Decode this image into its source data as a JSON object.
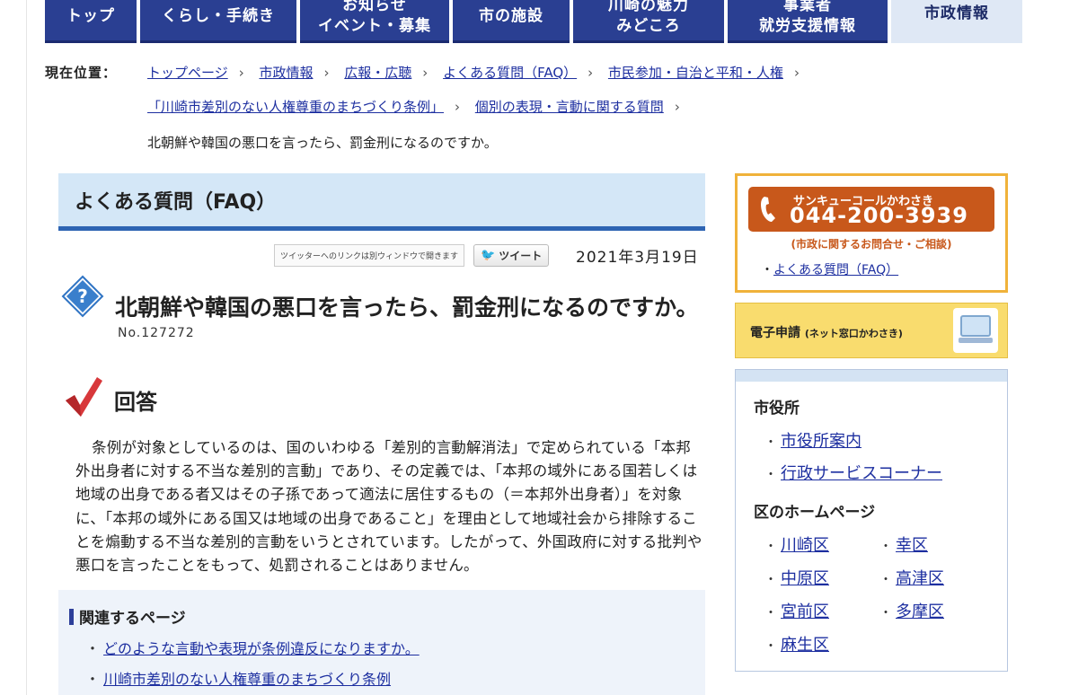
{
  "nav": {
    "items": [
      {
        "label": "トップ",
        "active": false
      },
      {
        "label": "くらし・手続き",
        "active": false
      },
      {
        "label": "お知らせ\nイベント・募集",
        "active": false
      },
      {
        "label": "市の施設",
        "active": false
      },
      {
        "label": "川崎の魅力\nみどころ",
        "active": false
      },
      {
        "label": "事業者\n就労支援情報",
        "active": false
      },
      {
        "label": "市政情報",
        "active": true
      }
    ]
  },
  "breadcrumb": {
    "label": "現在位置：",
    "links": [
      "トップページ",
      "市政情報",
      "広報・広聴",
      "よくある質問（FAQ）",
      "市民参加・自治と平和・人権",
      "「川崎市差別のない人権尊重のまちづくり条例」",
      "個別の表現・言動に関する質問"
    ],
    "separator": "›",
    "current": "北朝鮮や韓国の悪口を言ったら、罰金刑になるのですか。"
  },
  "faq": {
    "heading": "よくある質問（FAQ）",
    "twitter_note": "ツイッターへのリンクは別ウィンドウで開きます",
    "tweet_label": "ツイート",
    "date": "2021年3月19日",
    "question_title": "北朝鮮や韓国の悪口を言ったら、罰金刑になるのですか。",
    "question_no": "No.127272",
    "answer_heading": "回答",
    "answer_text": "条例が対象としているのは、国のいわゆる「差別的言動解消法」で定められている「本邦外出身者に対する不当な差別的言動」であり、その定義では、「本邦の域外にある国若しくは地域の出身である者又はその子孫であって適法に居住するもの（＝本邦外出身者）」を対象に、「本邦の域外にある国又は地域の出身であること」を理由として地域社会から排除することを煽動する不当な差別的言動をいうとされています。したがって、外国政府に対する批判や悪口を言ったことをもって、処罰されることはありません。"
  },
  "related": {
    "title": "関連するページ",
    "links": [
      "どのような言動や表現が条例違反になりますか。",
      "川崎市差別のない人権尊重のまちづくり条例"
    ]
  },
  "sidebar": {
    "call_name": "サンキューコールかわさき",
    "call_number": "044-200-3939",
    "call_sub": "(市政に関するお問合せ・ご相談)",
    "faq_link": "よくある質問（FAQ）",
    "eapply_label": "電子申請",
    "eapply_sub": "(ネット窓口かわさき)",
    "city_office_heading": "市役所",
    "city_office_links": [
      "市役所案内",
      "行政サービスコーナー"
    ],
    "ward_heading": "区のホームページ",
    "wards": [
      "川崎区",
      "幸区",
      "中原区",
      "高津区",
      "宮前区",
      "多摩区",
      "麻生区"
    ]
  },
  "colors": {
    "nav": "#2a3f92",
    "nav_active": "#dfe8f5",
    "link": "#1d2fa0",
    "faq_head": "#d4e7f7",
    "call": "#c8581b",
    "eapply": "#f9dc6e"
  }
}
